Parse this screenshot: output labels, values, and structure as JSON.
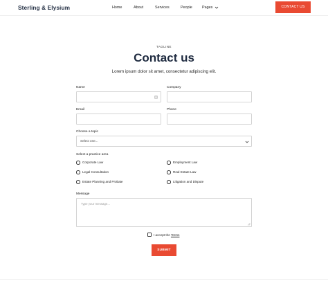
{
  "header": {
    "brand": "Sterling & Elysium",
    "nav": [
      {
        "label": "Home"
      },
      {
        "label": "About"
      },
      {
        "label": "Services"
      },
      {
        "label": "People"
      },
      {
        "label": "Pages"
      }
    ],
    "cta_label": "CONTACT US"
  },
  "hero": {
    "tagline": "TAGLINE",
    "title": "Contact us",
    "subtitle": "Lorem ipsum dolor sit amet, consectetur adipiscing elit."
  },
  "form": {
    "name_label": "Name",
    "company_label": "Company",
    "email_label": "Email",
    "phone_label": "Phone",
    "topic_label": "Choose a topic",
    "topic_selected": "Select one...",
    "practice_label": "Select a practice area",
    "practice_options": [
      "Corporate Law",
      "Employment Law",
      "Legal Consultation",
      "Real Estate Law",
      "Estate Planning and Probate",
      "Litigation and Dispute"
    ],
    "message_label": "Message",
    "message_placeholder": "Type your message...",
    "terms_prefix": "I accept the ",
    "terms_link": "Terms",
    "submit_label": "SUBMIT"
  },
  "colors": {
    "accent": "#e94a32",
    "heading": "#1f2b40"
  },
  "icons": {
    "pages_dropdown": "chevron-down-icon",
    "name_field": "contact-card-icon",
    "topic_select": "chevron-down-icon"
  }
}
